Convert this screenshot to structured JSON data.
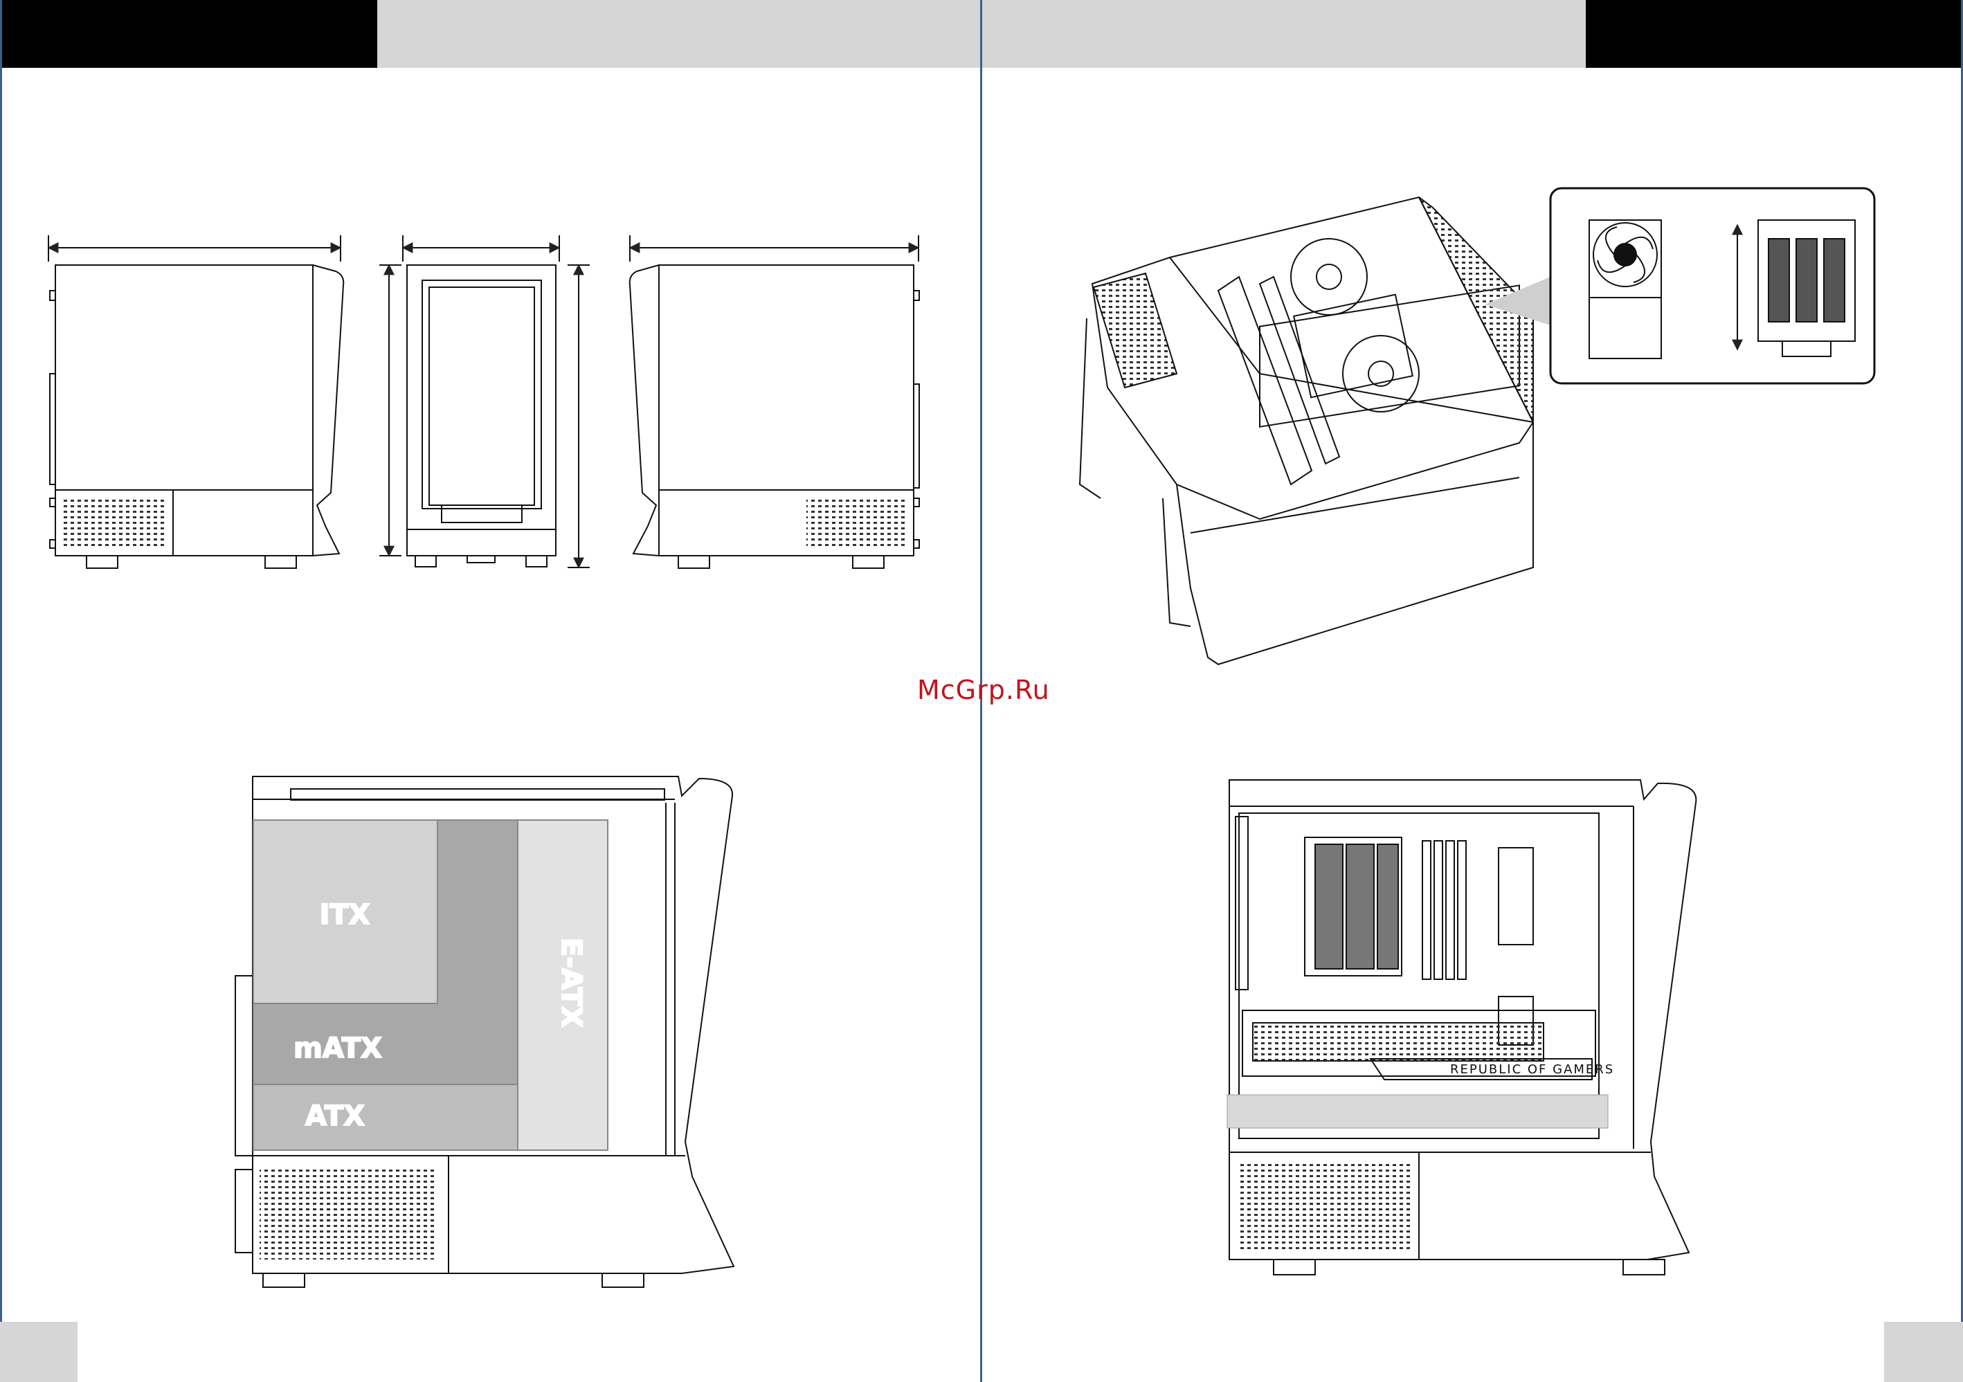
{
  "watermark": "McGrp.Ru",
  "mb_zones": {
    "itx": "ITX",
    "matx": "mATX",
    "atx": "ATX",
    "eatx": "E-ATX"
  },
  "gpu_brand": "REPUBLIC OF GAMERS",
  "colors": {
    "header_black": "#000000",
    "header_grey": "#d6d6d6",
    "page_divider": "#3d5f8d",
    "watermark": "#c0141c",
    "zone_itx": "#d2d2d2",
    "zone_matx": "#a8a8a8",
    "zone_atx": "#bdbdbd",
    "zone_eatx": "#e2e2e2",
    "gpu_bracket": "#d9d9d9"
  }
}
